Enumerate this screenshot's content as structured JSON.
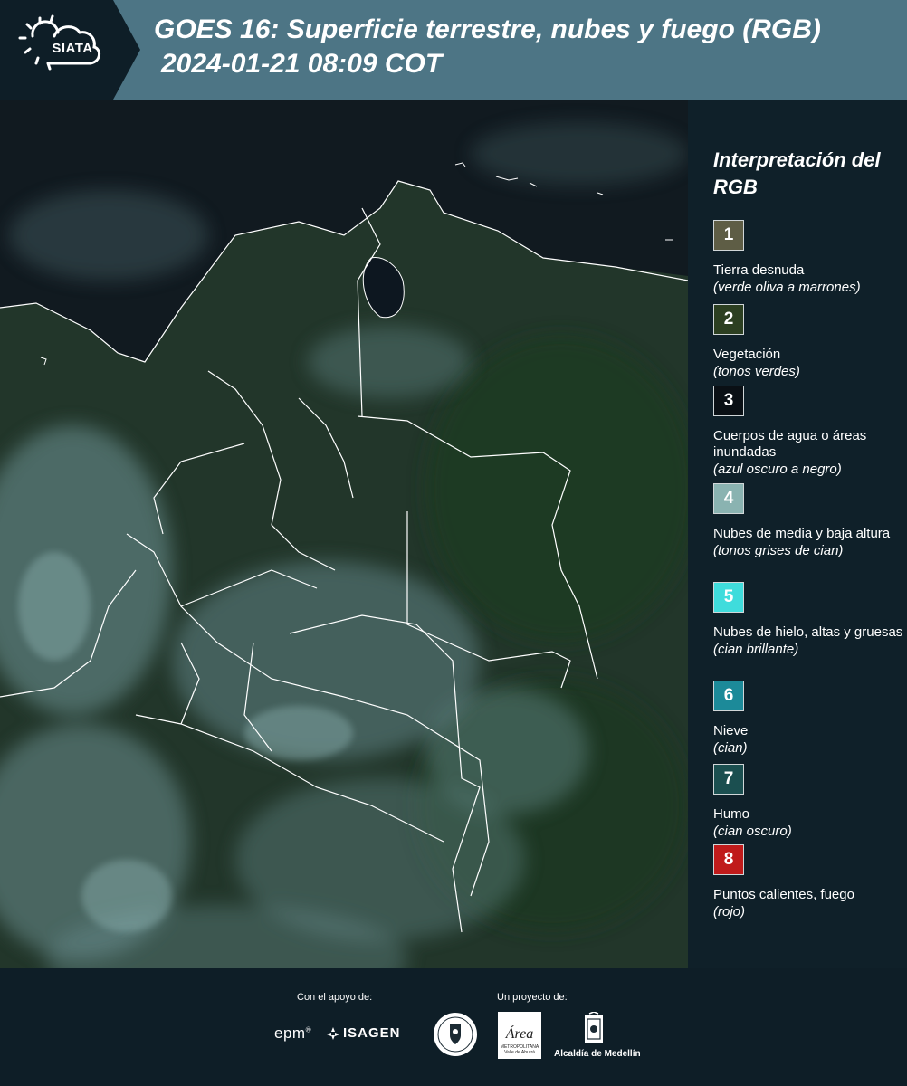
{
  "header": {
    "logo_text": "SIATA",
    "title_line1": "GOES 16: Superficie terrestre, nubes y fuego (RGB)",
    "title_line2": "2024-01-21 08:09 COT"
  },
  "legend": {
    "title": "Interpretación del RGB",
    "items": [
      {
        "number": "1",
        "name": "Tierra desnuda",
        "desc": "(verde oliva a marrones)",
        "color": "#5e5d45"
      },
      {
        "number": "2",
        "name": "Vegetación",
        "desc": "(tonos verdes)",
        "color": "#2c3f21"
      },
      {
        "number": "3",
        "name": "Cuerpos de agua o áreas inundadas",
        "desc": "(azul oscuro a negro)",
        "color": "#0a1015"
      },
      {
        "number": "4",
        "name": "Nubes de media y baja altura",
        "desc": "(tonos grises de cian)",
        "color": "#8ab3b1"
      },
      {
        "number": "5",
        "name": "Nubes de hielo, altas y gruesas",
        "desc": "(cian brillante)",
        "color": "#3fdcdc"
      },
      {
        "number": "6",
        "name": "Nieve",
        "desc": "(cian)",
        "color": "#1c8a99"
      },
      {
        "number": "7",
        "name": "Humo",
        "desc": "(cian oscuro)",
        "color": "#1b4f50"
      },
      {
        "number": "8",
        "name": "Puntos calientes, fuego",
        "desc": "(rojo)",
        "color": "#c01b1b"
      }
    ]
  },
  "footer": {
    "support_label": "Con el apoyo de:",
    "project_label": "Un proyecto de:",
    "epm": "epm",
    "epm_mark": "®",
    "isagen": "ISAGEN",
    "area_logo_text": "Área",
    "area_logo_sub": "METROPOLITANA Valle de Aburrá",
    "alcaldia": "Alcaldía de Medellín"
  },
  "map": {
    "ocean_color": "#0f161c",
    "land_color": "#24382c",
    "cloud_color": "#6f9598",
    "border_color": "#ffffff"
  }
}
